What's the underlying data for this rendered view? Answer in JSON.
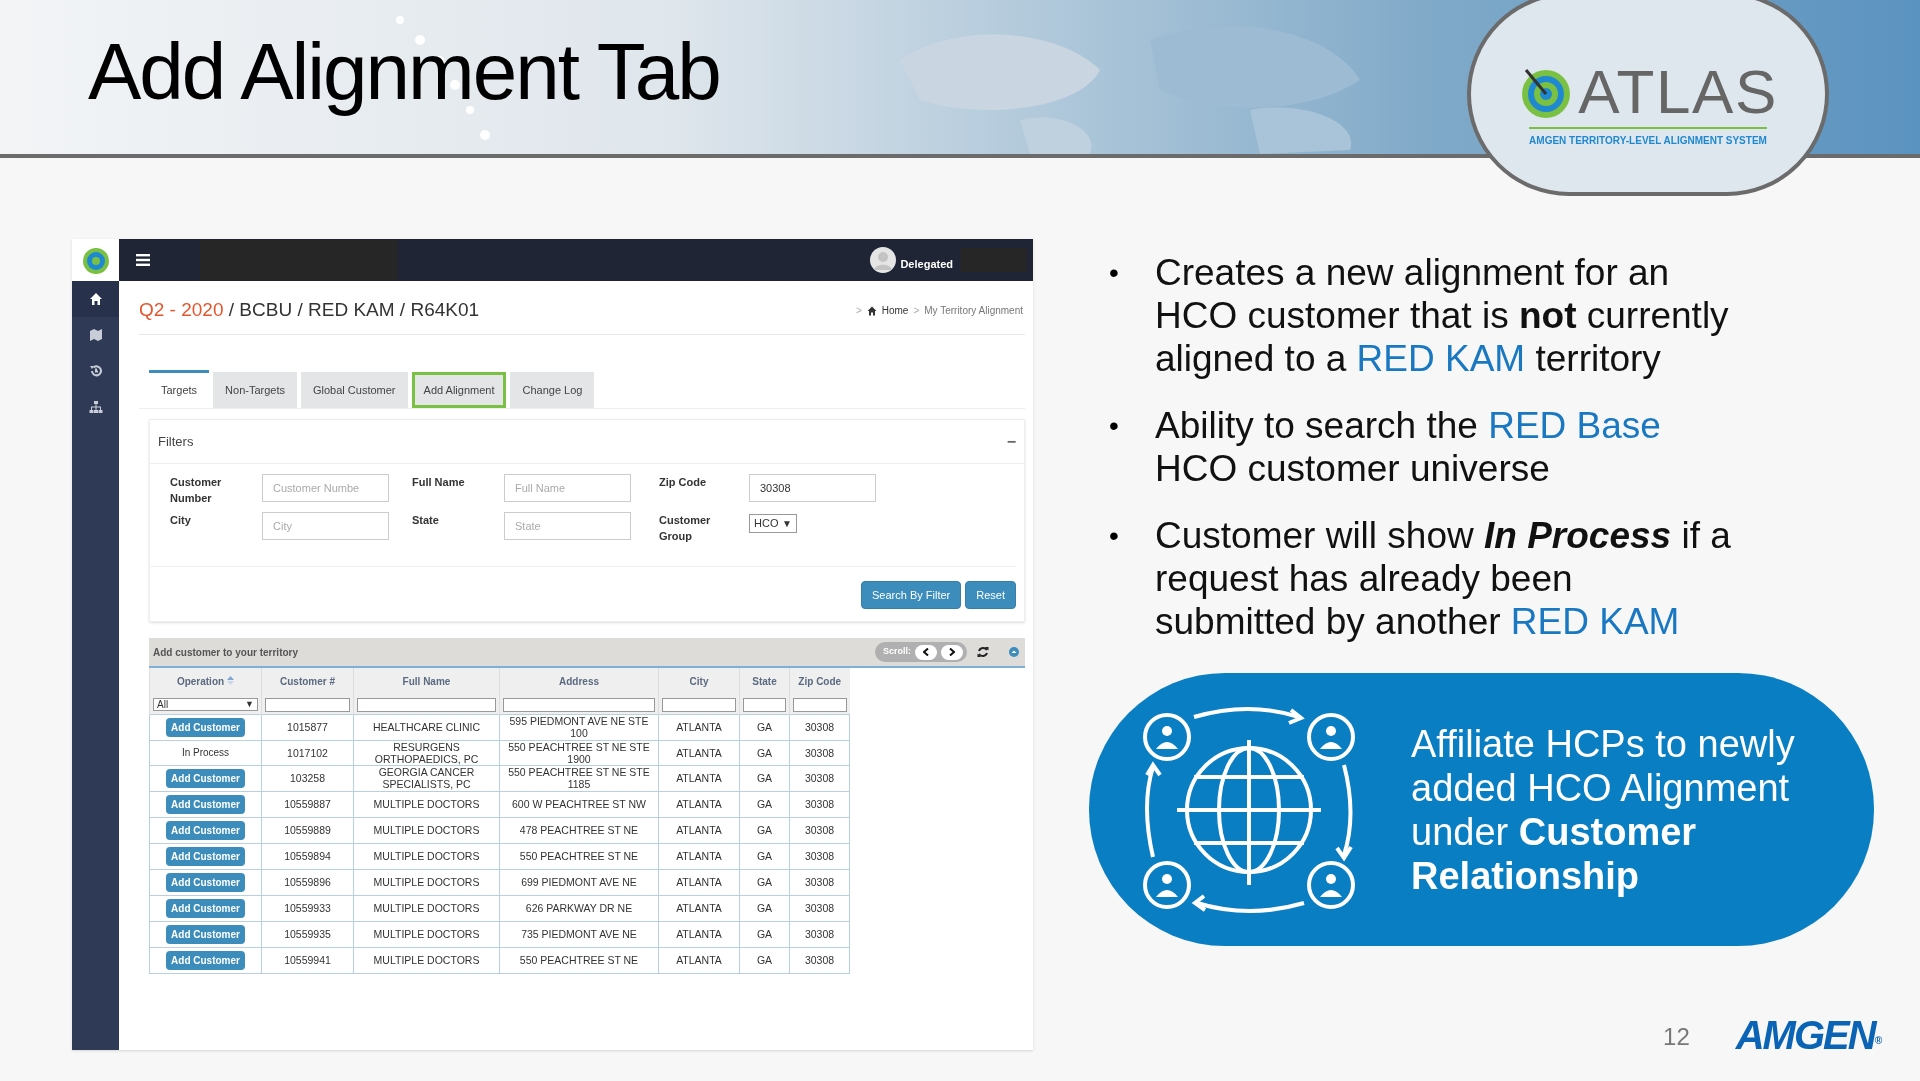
{
  "slide": {
    "title": "Add Alignment Tab",
    "page_number": "12",
    "brand": "AMGEN",
    "brand_mark": "®"
  },
  "logo": {
    "name": "ATLAS",
    "tagline": "AMGEN TERRITORY-LEVEL ALIGNMENT SYSTEM"
  },
  "app": {
    "user": "Delegated",
    "heading": {
      "period": "Q2 - 2020",
      "separator": "/",
      "path": [
        "BCBU",
        "RED KAM",
        "R64K01"
      ]
    },
    "breadcrumb": {
      "separator": ">",
      "items": [
        "Home",
        "My Territory Alignment"
      ]
    },
    "tabs": [
      {
        "label": "Targets",
        "selected": true,
        "outlined": false
      },
      {
        "label": "Non-Targets",
        "selected": false,
        "outlined": false
      },
      {
        "label": "Global Customer",
        "selected": false,
        "outlined": false
      },
      {
        "label": "Add Alignment",
        "selected": false,
        "outlined": true
      },
      {
        "label": "Change Log",
        "selected": false,
        "outlined": false
      }
    ],
    "filters": {
      "title": "Filters",
      "collapse": "−",
      "fields": [
        {
          "kind": "input",
          "label": "Customer Number",
          "placeholder": "Customer Numbe"
        },
        {
          "kind": "input",
          "label": "Full Name",
          "placeholder": "Full Name"
        },
        {
          "kind": "input",
          "label": "Zip Code",
          "value": "30308"
        },
        {
          "kind": "input",
          "label": "City",
          "placeholder": "City"
        },
        {
          "kind": "input",
          "label": "State",
          "placeholder": "State"
        },
        {
          "kind": "select",
          "label": "Customer Group",
          "value": "HCO",
          "caret": "▼"
        }
      ],
      "buttons": [
        "Search By Filter",
        "Reset"
      ]
    },
    "grid": {
      "title": "Add customer to your territory",
      "scroll_label": "Scroll:",
      "operation_column": {
        "label": "Operation",
        "sorted": true
      },
      "columns": [
        {
          "label": "Customer #",
          "sorted": false
        },
        {
          "label": "Full Name",
          "sorted": false
        },
        {
          "label": "Address",
          "sorted": false
        },
        {
          "label": "City",
          "sorted": false
        },
        {
          "label": "State",
          "sorted": false
        },
        {
          "label": "Zip Code",
          "sorted": false
        }
      ],
      "operation_filter": {
        "value": "All",
        "caret": "▼"
      },
      "rows": [
        {
          "operation": {
            "kind": "button",
            "text": "Add Customer"
          },
          "cells": [
            "1015877",
            "HEALTHCARE CLINIC",
            "595 PIEDMONT AVE NE STE 100",
            "ATLANTA",
            "GA",
            "30308"
          ]
        },
        {
          "operation": {
            "kind": "status",
            "text": "In Process"
          },
          "cells": [
            "1017102",
            "RESURGENS ORTHOPAEDICS, PC",
            "550 PEACHTREE ST NE STE 1900",
            "ATLANTA",
            "GA",
            "30308"
          ]
        },
        {
          "operation": {
            "kind": "button",
            "text": "Add Customer"
          },
          "cells": [
            "103258",
            "GEORGIA CANCER SPECIALISTS, PC",
            "550 PEACHTREE ST NE STE 1185",
            "ATLANTA",
            "GA",
            "30308"
          ]
        },
        {
          "operation": {
            "kind": "button",
            "text": "Add Customer"
          },
          "cells": [
            "10559887",
            "MULTIPLE DOCTORS",
            "600 W PEACHTREE ST NW",
            "ATLANTA",
            "GA",
            "30308"
          ]
        },
        {
          "operation": {
            "kind": "button",
            "text": "Add Customer"
          },
          "cells": [
            "10559889",
            "MULTIPLE DOCTORS",
            "478 PEACHTREE ST NE",
            "ATLANTA",
            "GA",
            "30308"
          ]
        },
        {
          "operation": {
            "kind": "button",
            "text": "Add Customer"
          },
          "cells": [
            "10559894",
            "MULTIPLE DOCTORS",
            "550 PEACHTREE ST NE",
            "ATLANTA",
            "GA",
            "30308"
          ]
        },
        {
          "operation": {
            "kind": "button",
            "text": "Add Customer"
          },
          "cells": [
            "10559896",
            "MULTIPLE DOCTORS",
            "699 PIEDMONT AVE NE",
            "ATLANTA",
            "GA",
            "30308"
          ]
        },
        {
          "operation": {
            "kind": "button",
            "text": "Add Customer"
          },
          "cells": [
            "10559933",
            "MULTIPLE DOCTORS",
            "626 PARKWAY DR NE",
            "ATLANTA",
            "GA",
            "30308"
          ]
        },
        {
          "operation": {
            "kind": "button",
            "text": "Add Customer"
          },
          "cells": [
            "10559935",
            "MULTIPLE DOCTORS",
            "735 PIEDMONT AVE NE",
            "ATLANTA",
            "GA",
            "30308"
          ]
        },
        {
          "operation": {
            "kind": "button",
            "text": "Add Customer"
          },
          "cells": [
            "10559941",
            "MULTIPLE DOCTORS",
            "550 PEACHTREE ST NE",
            "ATLANTA",
            "GA",
            "30308"
          ]
        }
      ]
    }
  },
  "bullet_mark": "•",
  "bullets": [
    [
      {
        "kind": "plain",
        "text": "Creates a new alignment for an HCO customer that is "
      },
      {
        "kind": "bold",
        "text": "not"
      },
      {
        "kind": "plain",
        "text": " currently aligned to a "
      },
      {
        "kind": "accent",
        "text": "RED KAM"
      },
      {
        "kind": "plain",
        "text": " territory"
      }
    ],
    [
      {
        "kind": "plain",
        "text": "Ability to search the "
      },
      {
        "kind": "accent",
        "text": "RED Base"
      },
      {
        "kind": "plain",
        "text": " HCO customer universe"
      }
    ],
    [
      {
        "kind": "plain",
        "text": "Customer will show "
      },
      {
        "kind": "bold_italic",
        "text": "In Process"
      },
      {
        "kind": "plain",
        "text": " if a request has already been submitted by another "
      },
      {
        "kind": "accent",
        "text": "RED KAM"
      }
    ]
  ],
  "callout": "Affiliate HCPs to newly added HCO Alignment under **Customer Relationship**"
}
